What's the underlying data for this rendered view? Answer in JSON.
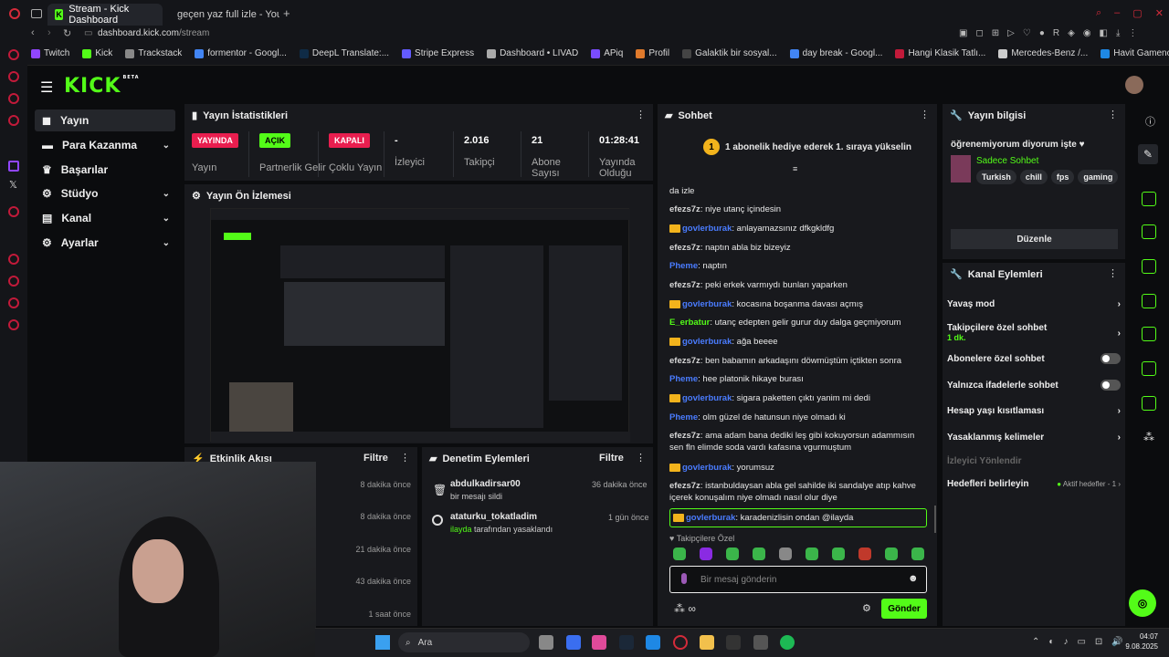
{
  "browser": {
    "tabs": [
      {
        "label": "Stream - Kick Dashboard"
      },
      {
        "label": "geçen yaz full izle - YouT"
      }
    ],
    "url_host": "dashboard.kick.com",
    "url_path": "/stream",
    "bookmarks": [
      "Twitch",
      "Kick",
      "Trackstack",
      "formentor - Googl...",
      "DeepL Translate:...",
      "Stripe Express",
      "Dashboard • LIVAD",
      "APiq",
      "Profil",
      "Galaktik bir sosyal...",
      "day break - Googl...",
      "Hangi Klasik Tatlı...",
      "Mercedes-Benz /...",
      "Havit Gamenote T..."
    ]
  },
  "sidebar": {
    "logo": "KICK",
    "logo_beta": "BETA",
    "items": [
      {
        "label": "Yayın"
      },
      {
        "label": "Para Kazanma"
      },
      {
        "label": "Başarılar"
      },
      {
        "label": "Stüdyo"
      },
      {
        "label": "Kanal"
      },
      {
        "label": "Ayarlar"
      }
    ]
  },
  "stats": {
    "title": "Yayın İstatistikleri",
    "items": [
      {
        "badge": "YAYINDA",
        "label": "Yayın"
      },
      {
        "badge": "AÇIK",
        "label": "Partnerlik Gelir"
      },
      {
        "badge": "KAPALI",
        "label": "Çoklu Yayın"
      },
      {
        "value": "-",
        "label": "İzleyici"
      },
      {
        "value": "2.016",
        "label": "Takipçi"
      },
      {
        "value": "21",
        "label": "Abone Sayısı"
      },
      {
        "value": "01:28:41",
        "label": "Yayında Olduğu"
      }
    ]
  },
  "preview": {
    "title": "Yayın Ön İzlemesi"
  },
  "activity": {
    "title": "Etkinlik Akışı",
    "filter": "Filtre",
    "times": [
      "8 dakika önce",
      "8 dakika önce",
      "21 dakika önce",
      "43 dakika önce",
      "1 saat önce"
    ]
  },
  "moderation": {
    "title": "Denetim Eylemleri",
    "filter": "Filtre",
    "rows": [
      {
        "user": "abdulkadirsar00",
        "time": "36 dakika önce",
        "detail": "bir mesajı sildi",
        "by": ""
      },
      {
        "user": "ataturku_tokatladim",
        "time": "1 gün önce",
        "detail": "tarafından yasaklandı",
        "by": "ilayda"
      }
    ]
  },
  "chat": {
    "title": "Sohbet",
    "gift_count": "1",
    "gift_text": "1 abonelik hediye ederek 1. sıraya yükselin",
    "partial_line": "da izle",
    "messages": [
      {
        "user": "efezs7z",
        "sub": false,
        "color": "#d8d8d8",
        "text": ": niye utanç içindesin"
      },
      {
        "user": "govlerburak",
        "sub": true,
        "color": "#4a7cff",
        "text": ": anlayamazsınız dfkgkldfg"
      },
      {
        "user": "efezs7z",
        "sub": false,
        "color": "#d8d8d8",
        "text": ": naptın abla biz bizeyiz"
      },
      {
        "user": "Pheme",
        "sub": false,
        "color": "#4a7cff",
        "text": ": naptın"
      },
      {
        "user": "efezs7z",
        "sub": false,
        "color": "#d8d8d8",
        "text": ": peki erkek varmıydı bunları yaparken"
      },
      {
        "user": "govlerburak",
        "sub": true,
        "color": "#4a7cff",
        "text": ": kocasına boşanma davası açmış"
      },
      {
        "user": "E_erbatur",
        "sub": false,
        "color": "#53fc18",
        "text": ": utanç edepten gelir gurur duy dalga geçmiyorum"
      },
      {
        "user": "govlerburak",
        "sub": true,
        "color": "#4a7cff",
        "text": ": ağa beeee"
      },
      {
        "user": "efezs7z",
        "sub": false,
        "color": "#d8d8d8",
        "text": ": ben babamın arkadaşını döwmüştüm içtikten sonra"
      },
      {
        "user": "Pheme",
        "sub": false,
        "color": "#4a7cff",
        "text": ": hee platonik hikaye burası"
      },
      {
        "user": "govlerburak",
        "sub": true,
        "color": "#4a7cff",
        "text": ": sigara paketten çıktı yanim mi dedi"
      },
      {
        "user": "Pheme",
        "sub": false,
        "color": "#4a7cff",
        "text": ": olm güzel de hatunsun niye olmadı ki"
      },
      {
        "user": "efezs7z",
        "sub": false,
        "color": "#d8d8d8",
        "text": ": ama adam bana dediki leş gibi kokuyorsun adammısın sen fln elimde soda vardı kafasına vgurmuştum"
      },
      {
        "user": "govlerburak",
        "sub": true,
        "color": "#4a7cff",
        "text": ": yorumsuz"
      },
      {
        "user": "efezs7z",
        "sub": false,
        "color": "#d8d8d8",
        "text": ": istanbuldaysan abla gel sahilde iki sandalye atıp kahve içerek konuşalım niye olmadı nasıl olur diye"
      },
      {
        "user": "govlerburak",
        "sub": true,
        "color": "#4a7cff",
        "text": ": karadenizlisin ondan @ilayda"
      }
    ],
    "followers_label": "Takipçilere Özel",
    "input_placeholder": "Bir mesaj gönderin",
    "send": "Gönder"
  },
  "stream_info": {
    "title": "Yayın bilgisi",
    "stream_title": "öğrenemiyorum diyorum işte ♥",
    "category": "Sadece Sohbet",
    "tags": [
      "Turkish",
      "chill",
      "fps",
      "gaming"
    ],
    "edit": "Düzenle"
  },
  "channel_actions": {
    "title": "Kanal Eylemleri",
    "items": [
      {
        "label": "Yavaş mod",
        "control": "chevron"
      },
      {
        "label": "Takipçilere özel sohbet",
        "sub": "1 dk.",
        "control": "chevron"
      },
      {
        "label": "Abonelere özel sohbet",
        "control": "toggle"
      },
      {
        "label": "Yalnızca ifadelerle sohbet",
        "control": "toggle"
      },
      {
        "label": "Hesap yaşı kısıtlaması",
        "control": "chevron"
      },
      {
        "label": "Yasaklanmış kelimeler",
        "control": "chevron"
      },
      {
        "label": "İzleyici Yönlendir",
        "control": "none"
      },
      {
        "label": "Hedefleri belirleyin",
        "aside": "Aktif hedefler - 1",
        "control": "chevron"
      }
    ]
  },
  "taskbar": {
    "search": "Ara",
    "time": "04:07",
    "date": "9.08.2025"
  },
  "colors": {
    "accent": "#53fc18",
    "live": "#e91e4f",
    "panel": "#18191d",
    "bg": "#0b0c0e"
  }
}
